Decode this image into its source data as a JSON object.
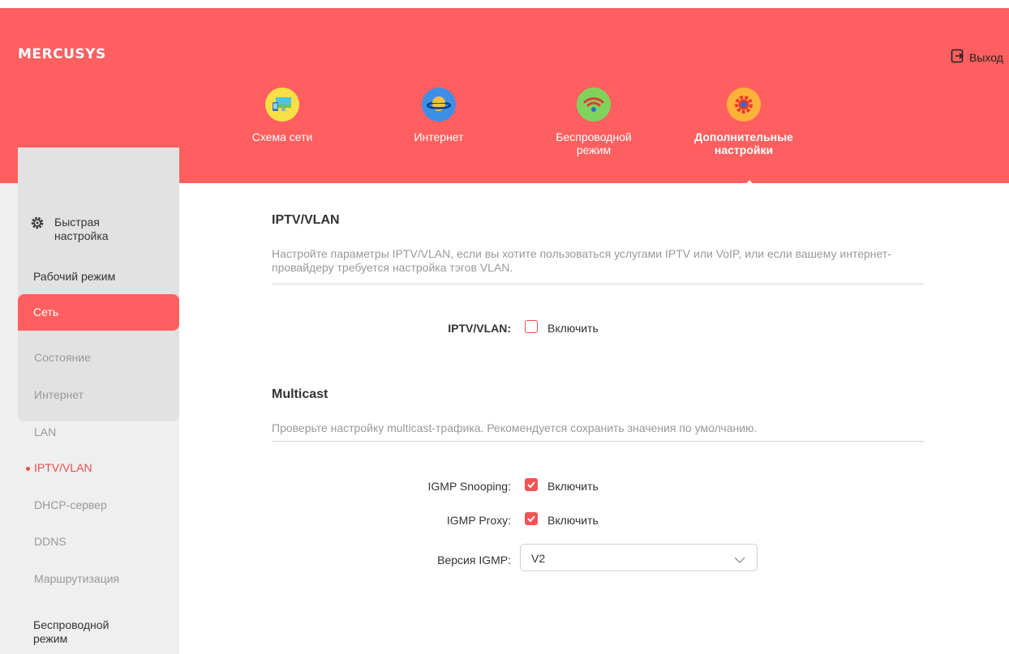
{
  "brand": {
    "logo": "MERCUSYS"
  },
  "header": {
    "logout_label": "Выход"
  },
  "topnav": [
    {
      "label": "Схема сети",
      "icon": "network-map-icon",
      "color": "#f7e046"
    },
    {
      "label": "Интернет",
      "icon": "globe-planet-icon",
      "color": "#3d8fe6"
    },
    {
      "label": "Беспроводной режим",
      "icon": "wifi-icon",
      "color": "#7fd35d"
    },
    {
      "label": "Дополнительные настройки",
      "icon": "gear-icon",
      "color": "#ffb23a"
    }
  ],
  "sidebar": {
    "quick_setup": "Быстрая настройка",
    "operation_mode": "Рабочий режим",
    "network": "Сеть",
    "sub": [
      "Состояние",
      "Интернет",
      "LAN",
      "IPTV/VLAN",
      "DHCP-сервер",
      "DDNS",
      "Маршрутизация"
    ],
    "wireless": "Беспроводной режим"
  },
  "iptv": {
    "title": "IPTV/VLAN",
    "desc": "Настройте параметры IPTV/VLAN, если вы хотите пользоваться услугами IPTV или VoIP, или если вашему интернет-провайдеру требуется настройка тэгов VLAN.",
    "label": "IPTV/VLAN:",
    "checkbox_text": "Включить",
    "checked": false
  },
  "multicast": {
    "title": "Multicast",
    "desc": "Проверьте настройку multicast-трафика. Рекомендуется сохранить значения по умолчанию.",
    "igmp_snooping_label": "IGMP Snooping:",
    "igmp_snooping_text": "Включить",
    "igmp_snooping_checked": true,
    "igmp_proxy_label": "IGMP Proxy:",
    "igmp_proxy_text": "Включить",
    "igmp_proxy_checked": true,
    "igmp_version_label": "Версия IGMP:",
    "igmp_version_value": "V2"
  },
  "colors": {
    "accent": "#ff5f5f",
    "sidebar_bg": "#efefef",
    "sub_bg": "#e2e2e2"
  }
}
